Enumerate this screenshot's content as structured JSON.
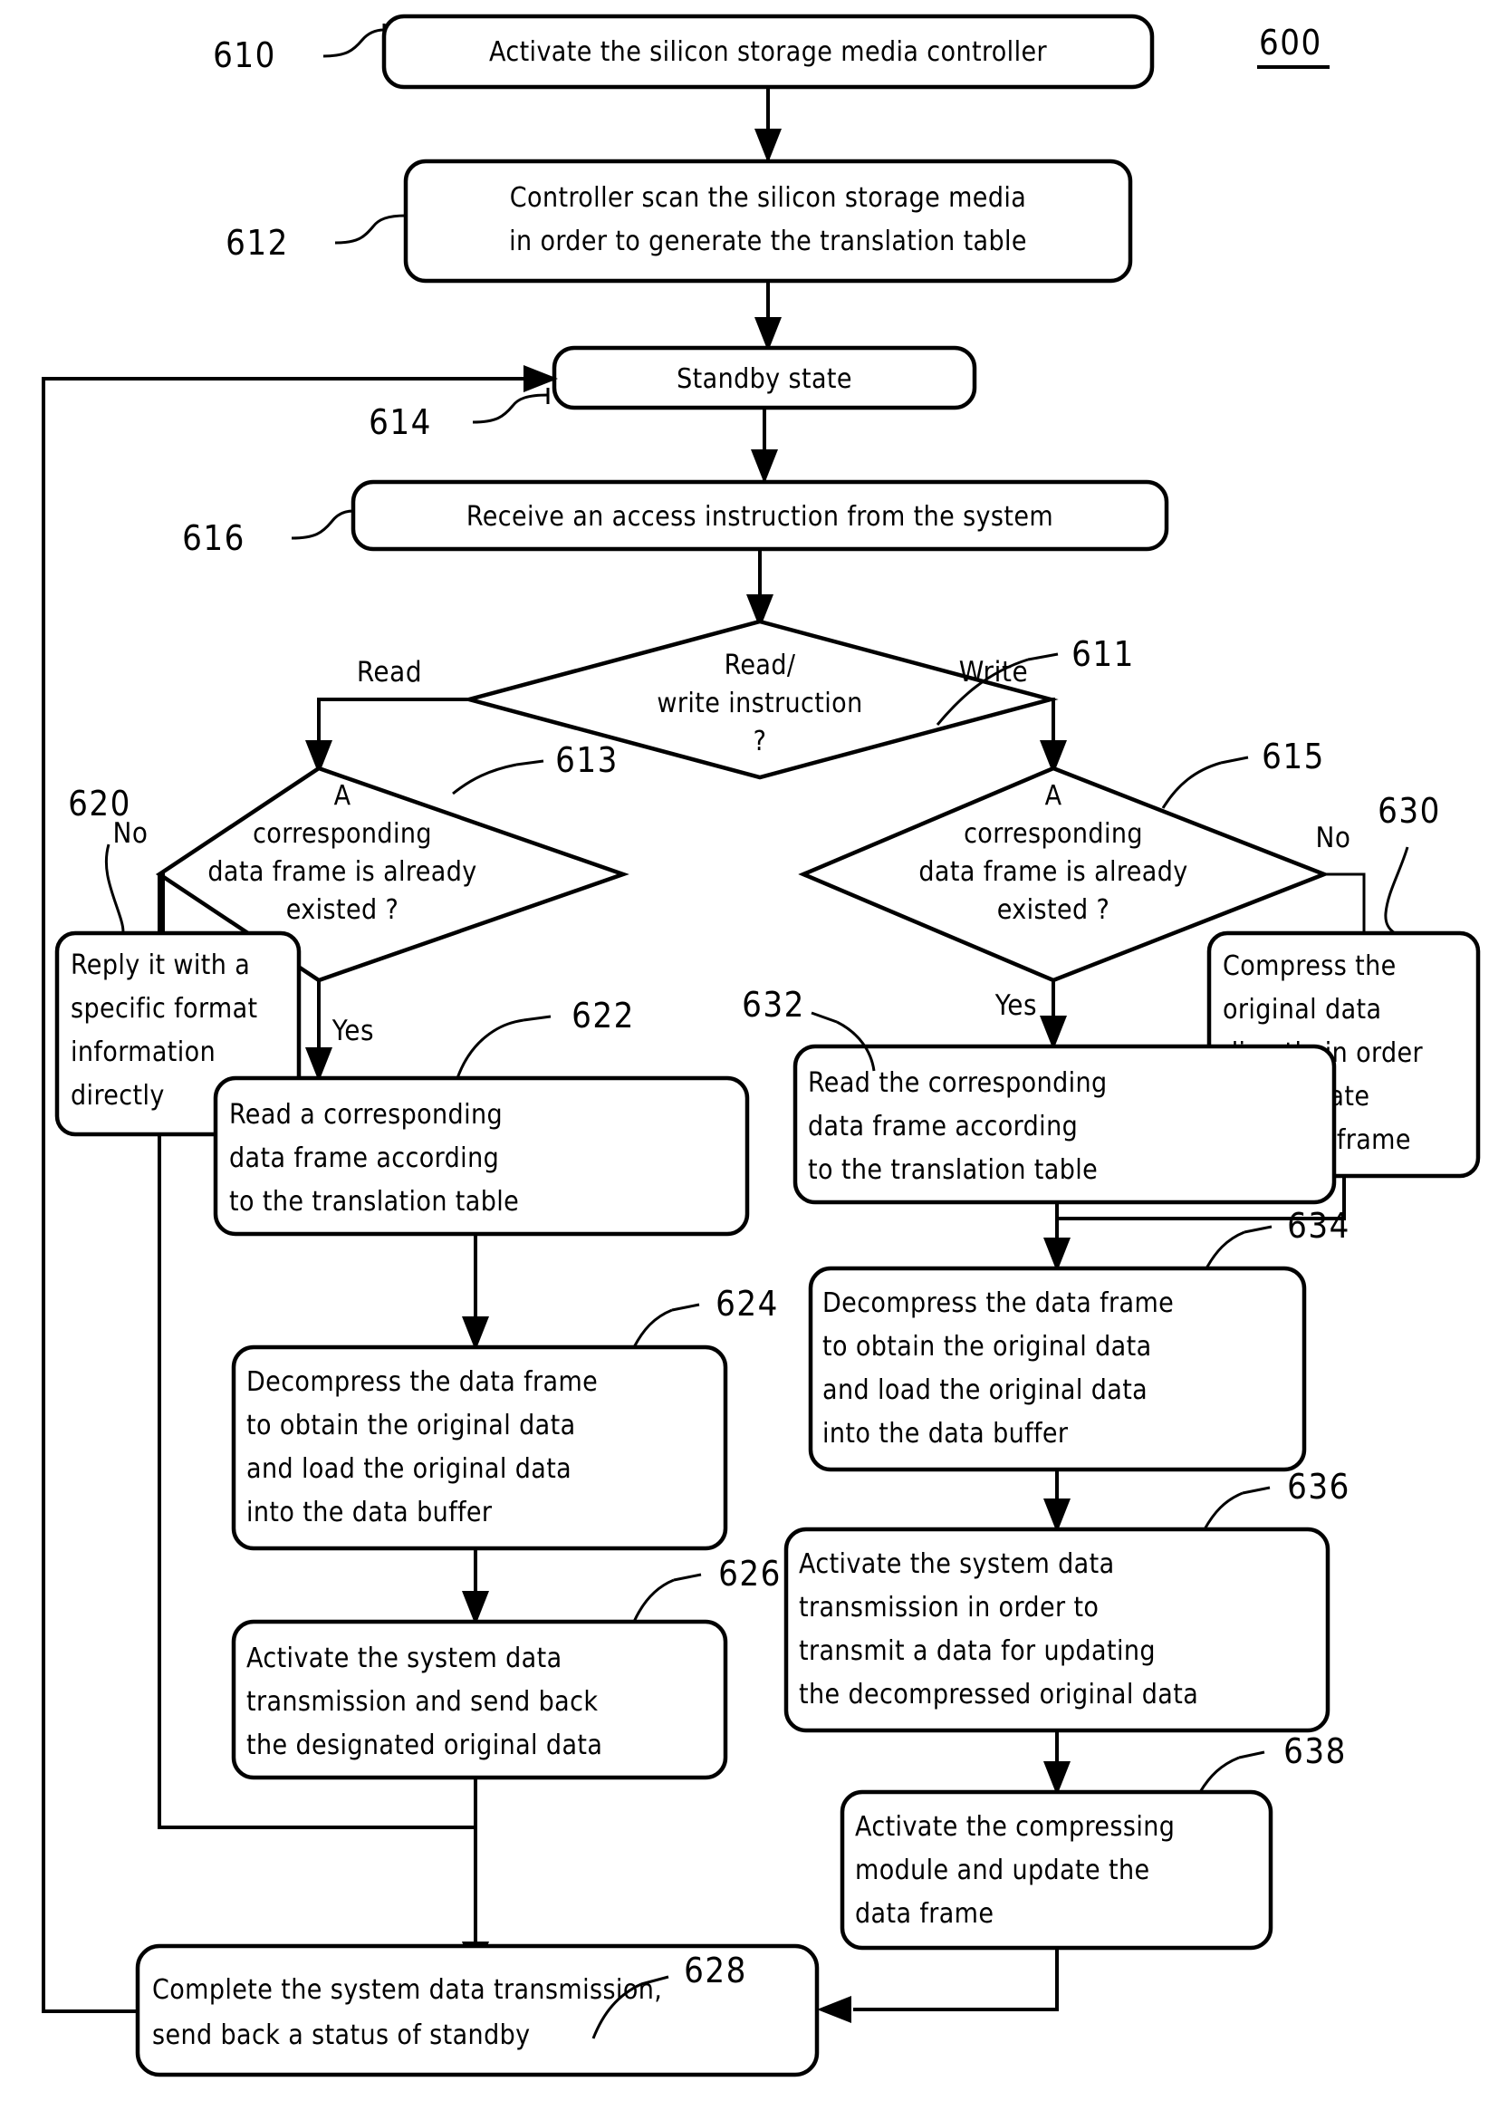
{
  "figure": {
    "number": "600",
    "type": "patent-flowchart"
  },
  "nodes": {
    "n610": {
      "ref": "610",
      "shape": "process",
      "lines": [
        "Activate the silicon storage media controller"
      ]
    },
    "n612": {
      "ref": "612",
      "shape": "process",
      "lines": [
        "Controller scan the silicon storage media",
        "in order to generate the translation table"
      ]
    },
    "n614": {
      "ref": "614",
      "shape": "process",
      "lines": [
        "Standby state"
      ]
    },
    "n616": {
      "ref": "616",
      "shape": "process",
      "lines": [
        "Receive an access instruction from the system"
      ]
    },
    "n611": {
      "ref": "611",
      "shape": "decision",
      "lines": [
        "Read/",
        "write instruction",
        "?"
      ]
    },
    "n613": {
      "ref": "613",
      "shape": "decision",
      "lines": [
        "A",
        "corresponding",
        "data frame is already",
        "existed ?"
      ]
    },
    "n615": {
      "ref": "615",
      "shape": "decision",
      "lines": [
        "A",
        "corresponding",
        "data frame is already",
        "existed ?"
      ]
    },
    "n620": {
      "ref": "620",
      "shape": "process",
      "lines": [
        "Reply it with a",
        "specific format",
        "information",
        "directly"
      ]
    },
    "n622": {
      "ref": "622",
      "shape": "process",
      "lines": [
        "Read a corresponding",
        "data frame according",
        "to the translation table"
      ]
    },
    "n624": {
      "ref": "624",
      "shape": "process",
      "lines": [
        "Decompress the data frame",
        "to obtain the original data",
        "and load the original data",
        "into the data buffer"
      ]
    },
    "n626": {
      "ref": "626",
      "shape": "process",
      "lines": [
        "Activate the system data",
        "transmission and send back",
        "the designated original data"
      ]
    },
    "n628": {
      "ref": "628",
      "shape": "process",
      "lines": [
        "Complete the system data transmission,",
        "send back a status of standby"
      ]
    },
    "n630": {
      "ref": "630",
      "shape": "process",
      "lines": [
        "Compress the",
        "original data",
        "directly in order",
        "to generate",
        "the data frame"
      ]
    },
    "n632": {
      "ref": "632",
      "shape": "process",
      "lines": [
        "Read the corresponding",
        "data frame according",
        "to the translation table"
      ]
    },
    "n634": {
      "ref": "634",
      "shape": "process",
      "lines": [
        "Decompress the data frame",
        "to obtain the original data",
        "and load the original data",
        "into the data buffer"
      ]
    },
    "n636": {
      "ref": "636",
      "shape": "process",
      "lines": [
        "Activate the system data",
        "transmission in order to",
        "transmit a data for updating",
        "the decompressed original data"
      ]
    },
    "n638": {
      "ref": "638",
      "shape": "process",
      "lines": [
        "Activate the compressing",
        "module and update the",
        "data frame"
      ]
    }
  },
  "edge_labels": {
    "read": "Read",
    "write": "Write",
    "no_left": "No",
    "yes_left": "Yes",
    "no_right": "No",
    "yes_right": "Yes"
  },
  "colors": {
    "stroke": "#000000",
    "background": "#ffffff",
    "text": "#000000"
  }
}
